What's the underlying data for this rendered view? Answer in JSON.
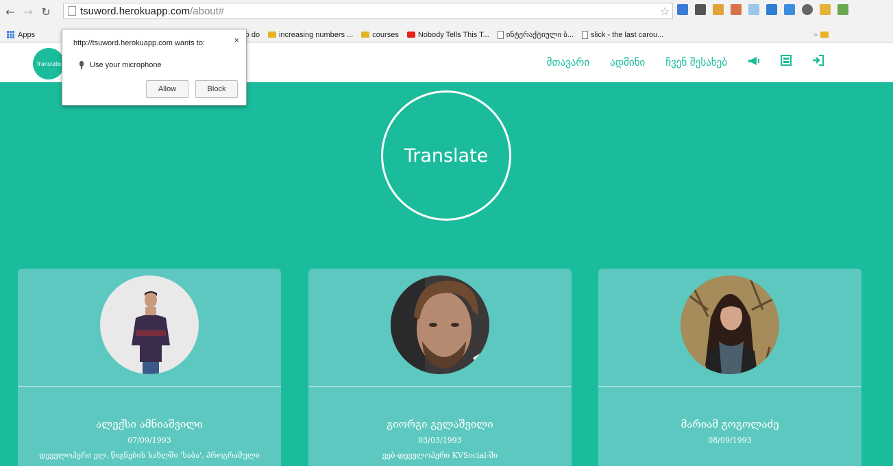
{
  "browser": {
    "url_host": "tsuword.herokuapp.com",
    "url_path": "/about#",
    "back_icon": "back-arrow-icon",
    "forward_icon": "forward-arrow-icon",
    "reload_icon": "reload-icon"
  },
  "bookmarks": [
    {
      "label": "Apps",
      "icon": "apps-icon"
    },
    {
      "label": "2015 to do",
      "icon": "folder-icon"
    },
    {
      "label": "increasing numbers ...",
      "icon": "folder-icon"
    },
    {
      "label": "courses",
      "icon": "folder-icon"
    },
    {
      "label": "Nobody Tells This T...",
      "icon": "youtube-icon"
    },
    {
      "label": "ინტერაქტიული ბ...",
      "icon": "page-icon"
    },
    {
      "label": "slick - the last carou...",
      "icon": "page-icon"
    }
  ],
  "permission_popup": {
    "title": "http://tsuword.herokuapp.com wants to:",
    "request": "Use your microphone",
    "allow_label": "Allow",
    "block_label": "Block",
    "close_label": "×"
  },
  "header": {
    "logo_text": "Translate",
    "nav": [
      "მთავარი",
      "ადმინი",
      "ჩვენ შესახებ"
    ]
  },
  "hero": {
    "title": "Translate"
  },
  "team": [
    {
      "name": "ალექსი ამნიაშვილი",
      "date": "07/09/1993",
      "description": "დეველოპერი ელ. წიგნების სახლში 'საბა', პროგრამული"
    },
    {
      "name": "გიორგი გელაშვილი",
      "date": "03/03/1993",
      "description": "ვებ-დეველოპერი KVSocial-ში"
    },
    {
      "name": "მარიამ გოგოლაძე",
      "date": "08/09/1993",
      "description": ""
    }
  ],
  "colors": {
    "accent": "#1abc9c",
    "card": "#5cc8bf"
  }
}
